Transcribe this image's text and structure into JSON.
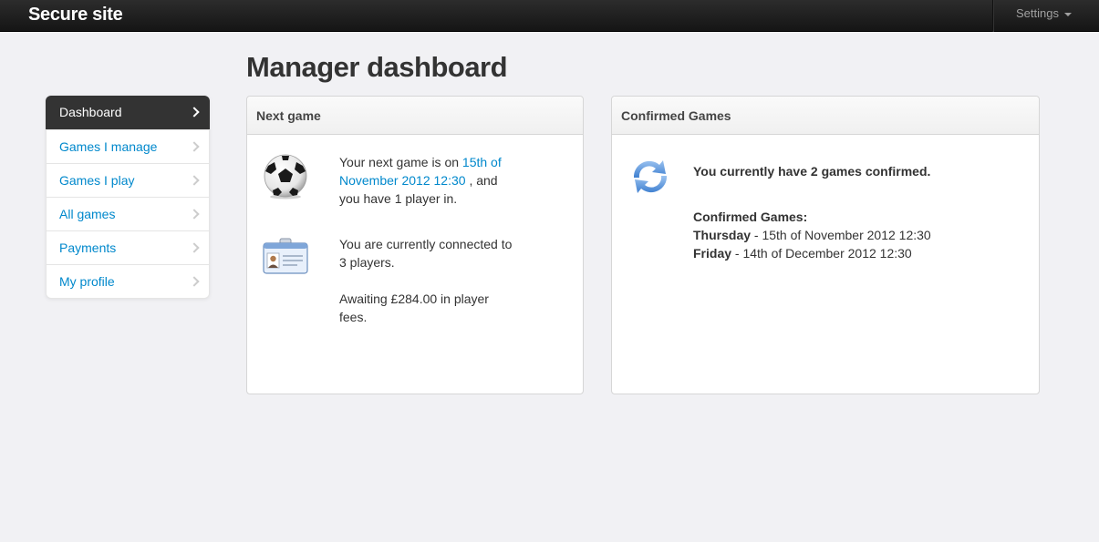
{
  "navbar": {
    "brand": "Secure site",
    "settings_label": "Settings"
  },
  "page": {
    "title": "Manager dashboard"
  },
  "sidebar": {
    "items": [
      {
        "label": "Dashboard",
        "active": true
      },
      {
        "label": "Games I manage"
      },
      {
        "label": "Games I play"
      },
      {
        "label": "All games"
      },
      {
        "label": "Payments"
      },
      {
        "label": "My profile"
      }
    ]
  },
  "next_game": {
    "heading": "Next game",
    "game_prefix": "Your next game is on",
    "game_date_link": "15th of November 2012 12:30",
    "game_suffix": ", and you have 1 player in.",
    "connected_text": "You are currently connected to 3 players.",
    "awaiting_text": "Awaiting £284.00 in player fees."
  },
  "confirmed": {
    "heading": "Confirmed Games",
    "summary": "You currently have 2 games confirmed.",
    "list_heading": "Confirmed Games:",
    "games": [
      {
        "day": "Thursday",
        "date": "15th of November 2012 12:30"
      },
      {
        "day": "Friday",
        "date": "14th of December 2012 12:30"
      }
    ]
  },
  "colors": {
    "link": "#0088cc",
    "navbar": "#1b1b1b",
    "sidebar_active": "#333333",
    "background": "#f1f1f4"
  },
  "icons": [
    "football-icon",
    "id-card-icon",
    "refresh-icon",
    "chevron-right-icon",
    "caret-down-icon"
  ]
}
